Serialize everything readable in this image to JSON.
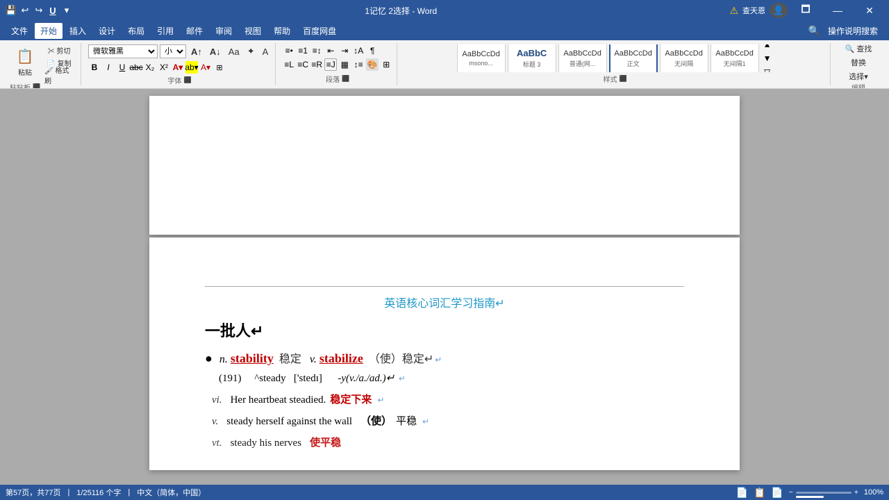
{
  "titlebar": {
    "left_icons": [
      "💾",
      "↩",
      "↪",
      "U",
      "▼"
    ],
    "title": "1记忆 2选择  - Word",
    "warning_icon": "⚠",
    "warning_text": "查天恩",
    "right_buttons": [
      "🗖",
      "—",
      "✕"
    ]
  },
  "menubar": {
    "items": [
      "文件",
      "开始",
      "插入",
      "设计",
      "布局",
      "引用",
      "邮件",
      "审阅",
      "视图",
      "帮助",
      "百度网盘",
      "操作说明搜索"
    ],
    "active": "开始"
  },
  "ribbon": {
    "clipboard_label": "粘贴板",
    "font_label": "字体",
    "paragraph_label": "段落",
    "styles_label": "样式",
    "edit_label": "编辑",
    "font_name": "微软雅黑",
    "font_size": "小四",
    "styles": [
      {
        "label": "msonо...",
        "preview": "AaBbCcDd",
        "class": "normal"
      },
      {
        "label": "标题 3",
        "preview": "AaBbC",
        "class": "h3"
      },
      {
        "label": "普通(网...",
        "preview": "AaBbCcDd",
        "class": "normal2"
      },
      {
        "label": "正文",
        "preview": "AaBbCcDd",
        "class": "body",
        "active": true
      },
      {
        "label": "无间隔",
        "preview": "AaBbCcDd",
        "class": "nosp"
      },
      {
        "label": "无间隔1",
        "preview": "AaBbCcDd",
        "class": "nosp1"
      }
    ],
    "edit_items": [
      "查找",
      "替换",
      "选择"
    ]
  },
  "document": {
    "title": "英语核心词汇学习指南↵",
    "section": "一批人↵",
    "entry": {
      "bullet": "●",
      "pos1": "n.",
      "word1": "stability",
      "cn1": "稳定",
      "pos2": "v.",
      "word2": "stabilize",
      "cn2": "（使）稳定↵"
    },
    "phonetic": {
      "num": "(191)",
      "caret": "^steady",
      "ipa": "['stedɪ]",
      "suffix": "-y(v./a./ad.)↵"
    },
    "examples": [
      {
        "pos": "vi.",
        "text": "Her heartbeat steadied.",
        "cn_red": "稳定下来",
        "cn_end": "↵"
      },
      {
        "pos": "v.",
        "text": "steady herself against the wall",
        "cn": "（使）平稳↵"
      },
      {
        "pos": "vt.",
        "text": "steady his nerves",
        "cn_red": "使平稳",
        "partial": true
      }
    ]
  },
  "statusbar": {
    "page": "第57页，共77页",
    "words": "1/25116 个字",
    "lang": "中文（简体，中国）",
    "view_icons": [
      "📄",
      "📋",
      "📄"
    ],
    "zoom": "100%",
    "zoom_pct": "100"
  }
}
